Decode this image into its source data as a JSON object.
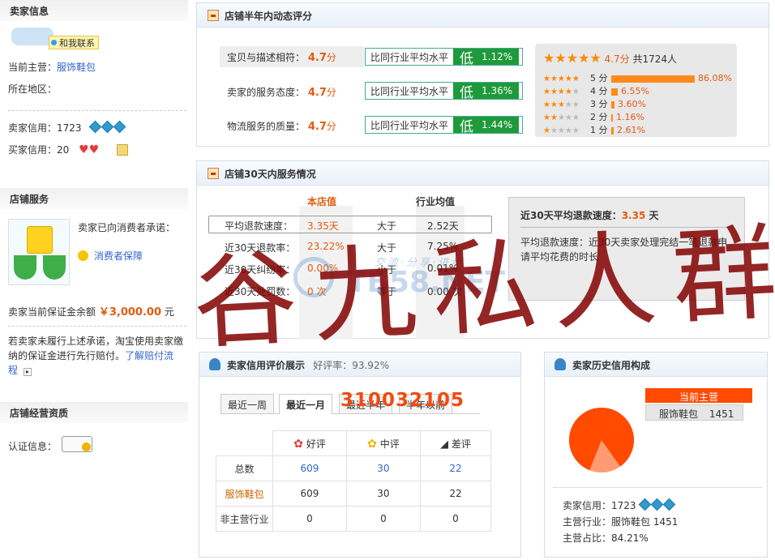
{
  "left": {
    "seller_info_title": "卖家信息",
    "contact_label": "和我联系",
    "main_business_label": "当前主营：",
    "main_business_value": "服饰鞋包",
    "region_label": "所在地区：",
    "seller_credit_label": "卖家信用：",
    "seller_credit_value": "1723",
    "buyer_credit_label": "买家信用：",
    "buyer_credit_value": "20",
    "shop_service_title": "店铺服务",
    "promise_text": "卖家已向消费者承诺：",
    "consumer_protection": "消费者保障",
    "deposit_label": "卖家当前保证金余额",
    "deposit_value": "￥3,000.00",
    "deposit_unit": "元",
    "notice_text_1": "若卖家未履行上述承诺，淘宝使用卖家缴",
    "notice_text_2": "纳的保证金进行先行赔付。",
    "notice_link": "了解赔付流",
    "notice_link_2": "程",
    "qualification_title": "店铺经营资质",
    "cert_label": "认证信息："
  },
  "rating": {
    "title": "店铺半年内动态评分",
    "items": [
      {
        "label": "宝贝与描述相符：",
        "score": "4.7",
        "unit": "分",
        "cmp": "比同行业平均水平",
        "level": "低",
        "pct": "1.12%"
      },
      {
        "label": "卖家的服务态度：",
        "score": "4.7",
        "unit": "分",
        "cmp": "比同行业平均水平",
        "level": "低",
        "pct": "1.36%"
      },
      {
        "label": "物流服务的质量：",
        "score": "4.7",
        "unit": "分",
        "cmp": "比同行业平均水平",
        "level": "低",
        "pct": "1.44%"
      }
    ],
    "summary_score": "4.7分",
    "summary_count": "共1724人",
    "dist": [
      {
        "label": "5 分",
        "pct": "86.08%",
        "value": 86.08
      },
      {
        "label": "4 分",
        "pct": "6.55%",
        "value": 6.55
      },
      {
        "label": "3 分",
        "pct": "3.60%",
        "value": 3.6
      },
      {
        "label": "2 分",
        "pct": "1.16%",
        "value": 1.16
      },
      {
        "label": "1 分",
        "pct": "2.61%",
        "value": 2.61
      }
    ]
  },
  "service": {
    "title": "店铺30天内服务情况",
    "col_store": "本店值",
    "col_avg": "行业均值",
    "rows": [
      {
        "label": "平均退款速度：",
        "store": "3.35天",
        "cmp": "大于",
        "avg": "2.52天"
      },
      {
        "label": "近30天退款率：",
        "store": "23.22%",
        "cmp": "大于",
        "avg": "7.25%"
      },
      {
        "label": "近30天纠纷率：",
        "store": "0.00%",
        "cmp": "小于",
        "avg": "0.01%"
      },
      {
        "label": "近30天处罚数：",
        "store": "0 次",
        "cmp": "等于",
        "avg": "0.00 次"
      }
    ],
    "tip_title": "近30天平均退款速度：",
    "tip_value": "3.35",
    "tip_unit": "天",
    "tip_text_1": "平均退款速度：近30天卖家处理完结一笔退款申",
    "tip_text_2": "请平均花费的时长"
  },
  "credit": {
    "title": "卖家信用评价展示",
    "good_rate_label": "好评率：",
    "good_rate_value": "93.92%",
    "tabs": [
      "最近一周",
      "最近一月",
      "最近半年",
      "半年以前"
    ],
    "head": [
      "好评",
      "中评",
      "差评"
    ],
    "rows": [
      {
        "label": "总数",
        "good": "609",
        "mid": "30",
        "bad": "22"
      },
      {
        "label": "服饰鞋包",
        "good": "609",
        "mid": "30",
        "bad": "22"
      },
      {
        "label": "非主营行业",
        "good": "0",
        "mid": "0",
        "bad": "0"
      }
    ]
  },
  "history": {
    "title": "卖家历史信用构成",
    "legend_label": "当前主营",
    "legend_item": "服饰鞋包",
    "legend_value": "1451",
    "share": 84.21,
    "seller_credit_label": "卖家信用：",
    "seller_credit_value": "1723",
    "main_industry_label": "主营行业：",
    "main_industry_value": "服饰鞋包 1451",
    "main_share_label": "主营占比：",
    "main_share_value": "84.21%"
  },
  "overlay": {
    "handwriting": "谷九私人群",
    "number": "310032105",
    "watermark_site": "TB58.NET",
    "watermark_slogan": "交流·分享·进步"
  },
  "colors": {
    "accent": "#e45a0e",
    "green": "#1f9a3a",
    "link": "#3366cc"
  }
}
